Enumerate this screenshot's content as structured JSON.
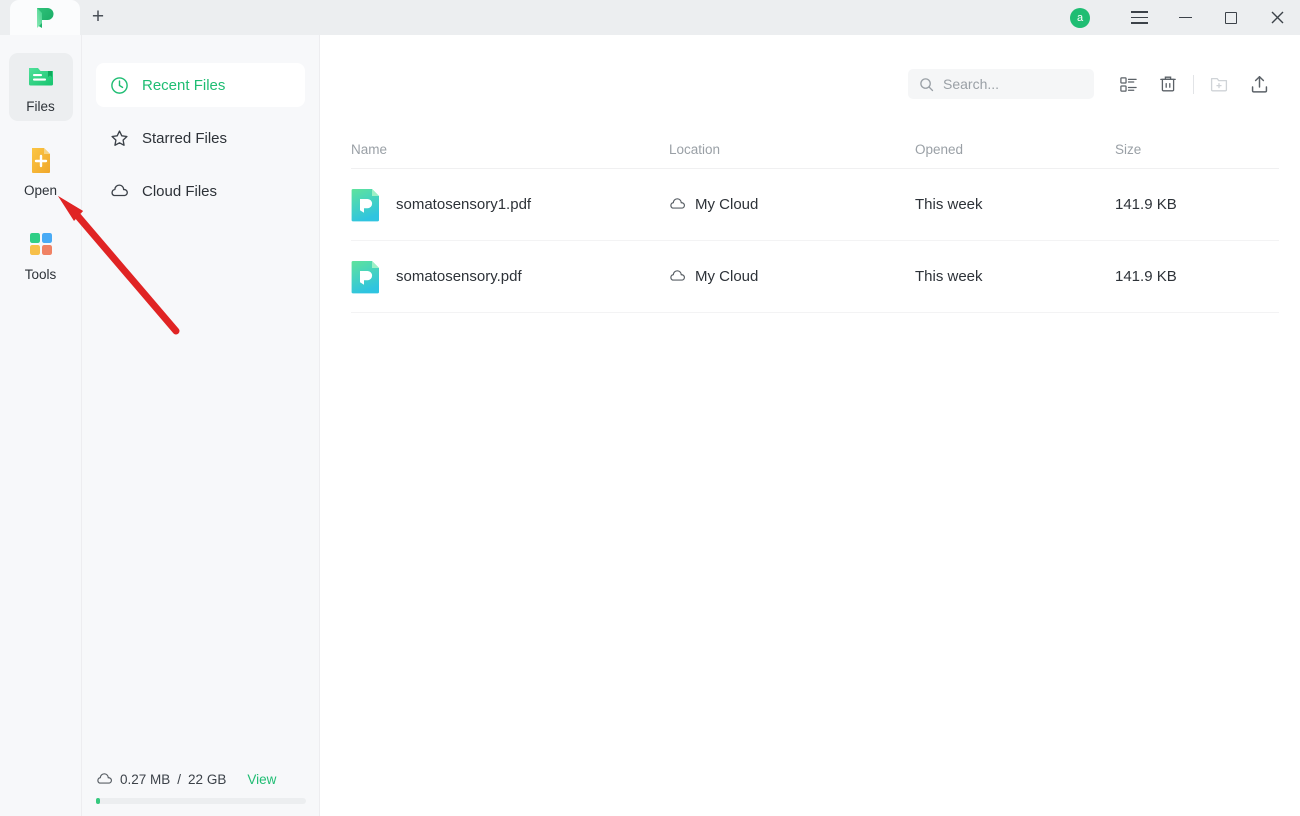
{
  "titlebar": {
    "logo_icon": "pdfelement-logo-icon",
    "new_tab_label": "+",
    "avatar_initial": "a",
    "menu_icon": "hamburger-menu-icon",
    "minimize_icon": "minimize-icon",
    "maximize_icon": "maximize-icon",
    "close_icon": "close-icon"
  },
  "rail": {
    "items": [
      {
        "label": "Files",
        "icon": "files-icon",
        "active": true
      },
      {
        "label": "Open",
        "icon": "open-document-plus-icon",
        "active": false
      },
      {
        "label": "Tools",
        "icon": "tools-grid-icon",
        "active": false
      }
    ]
  },
  "nav": {
    "items": [
      {
        "label": "Recent Files",
        "icon": "clock-icon",
        "active": true
      },
      {
        "label": "Starred Files",
        "icon": "star-icon",
        "active": false
      },
      {
        "label": "Cloud Files",
        "icon": "cloud-icon",
        "active": false
      }
    ],
    "storage": {
      "icon": "cloud-icon",
      "used": "0.27 MB",
      "separator": "/",
      "total": "22 GB",
      "view_label": "View",
      "percent": 2
    }
  },
  "toolbar": {
    "search_placeholder": "Search...",
    "search_value": "",
    "search_icon": "search-icon",
    "list_view_icon": "list-view-icon",
    "trash_icon": "trash-icon",
    "new_folder_icon": "new-folder-icon",
    "upload_icon": "upload-icon"
  },
  "table": {
    "columns": [
      "Name",
      "Location",
      "Opened",
      "Size"
    ],
    "rows": [
      {
        "name": "somatosensory1.pdf",
        "file_icon": "pdf-file-icon",
        "location": "My Cloud",
        "location_icon": "cloud-icon",
        "opened": "This week",
        "size": "141.9 KB"
      },
      {
        "name": "somatosensory.pdf",
        "file_icon": "pdf-file-icon",
        "location": "My Cloud",
        "location_icon": "cloud-icon",
        "opened": "This week",
        "size": "141.9 KB"
      }
    ]
  },
  "annotation": {
    "arrow_color": "#e02424",
    "arrow_icon": "pointer-arrow-annotation"
  },
  "colors": {
    "accent_green": "#1fbd73",
    "panel_bg": "#f7f8fa",
    "titlebar_bg": "#eceef0",
    "annotation_red": "#e02424"
  }
}
